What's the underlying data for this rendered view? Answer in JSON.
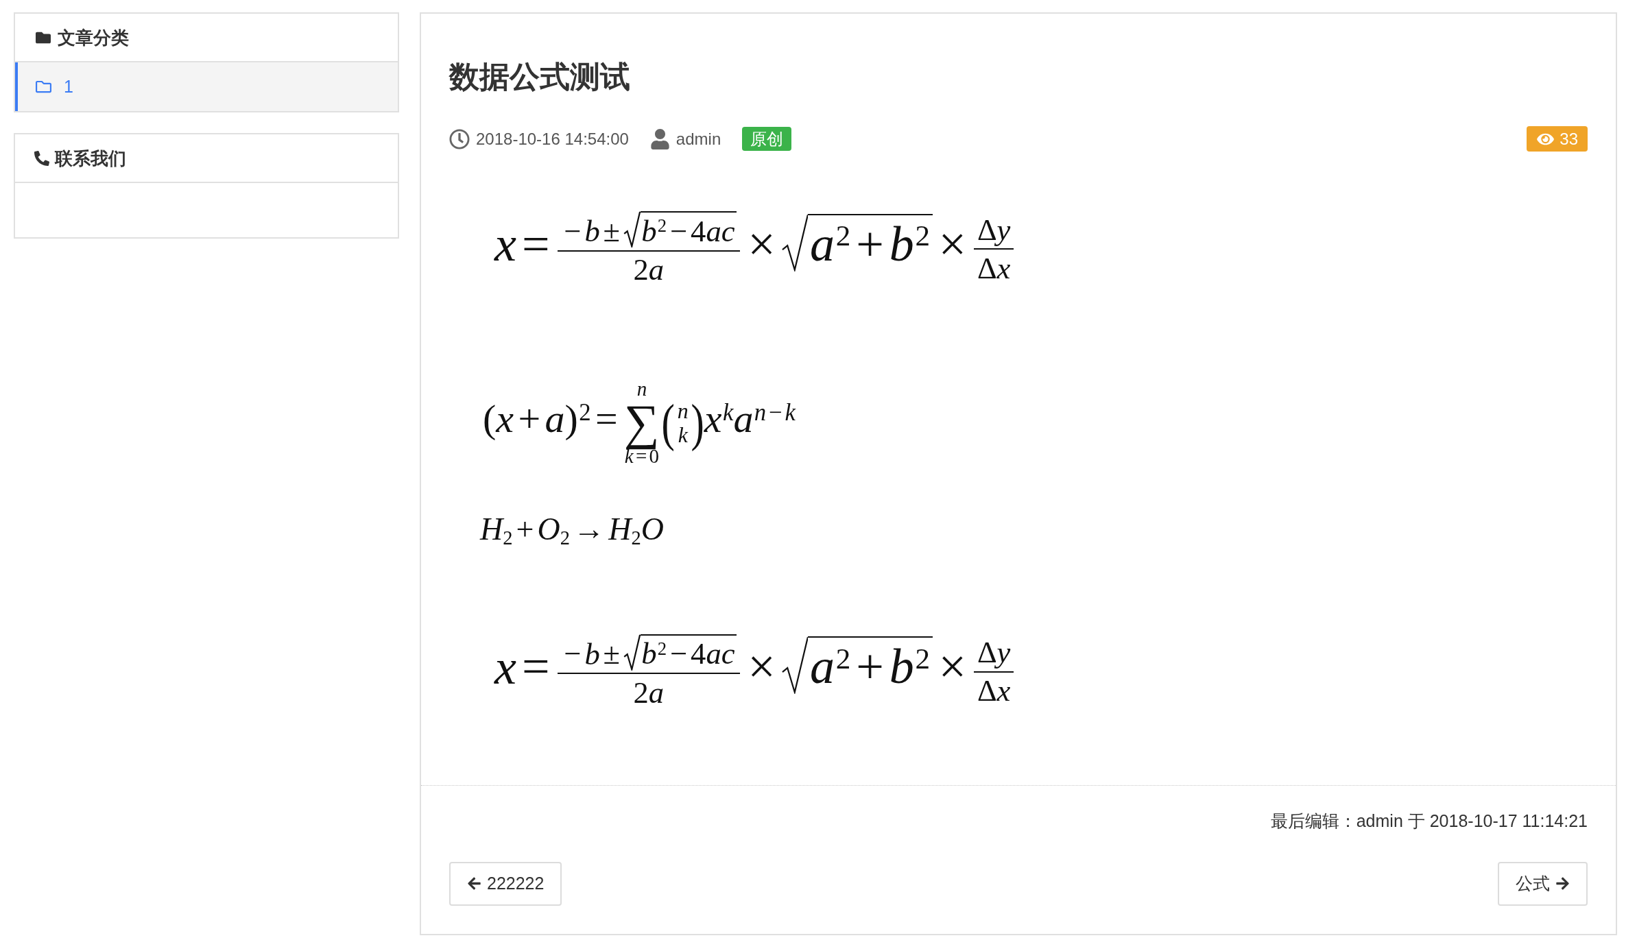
{
  "sidebar": {
    "panels": [
      {
        "kind": "categories",
        "title": "文章分类",
        "items": [
          {
            "label": "1",
            "selected": true
          }
        ]
      },
      {
        "kind": "contact",
        "title": "联系我们"
      }
    ]
  },
  "article": {
    "title": "数据公式测试",
    "meta": {
      "date": "2018-10-16 14:54:00",
      "author": "admin",
      "tag": "原创",
      "views": "33"
    },
    "formulas": [
      [
        {
          "kind": "var",
          "text": "x"
        },
        {
          "kind": "op",
          "text": "="
        },
        {
          "kind": "frac",
          "num": [
            {
              "kind": "op",
              "text": "−"
            },
            {
              "kind": "var",
              "text": "b"
            },
            {
              "kind": "op",
              "text": "±"
            },
            {
              "kind": "sqrt",
              "body": [
                {
                  "kind": "sup",
                  "base": [
                    {
                      "kind": "var",
                      "text": "b"
                    }
                  ],
                  "sup": [
                    {
                      "kind": "sym",
                      "text": "2"
                    }
                  ]
                },
                {
                  "kind": "op",
                  "text": "−"
                },
                {
                  "kind": "sym",
                  "text": "4"
                },
                {
                  "kind": "var",
                  "text": "ac"
                }
              ]
            }
          ],
          "den": [
            {
              "kind": "sym",
              "text": "2"
            },
            {
              "kind": "var",
              "text": "a"
            }
          ]
        },
        {
          "kind": "op",
          "text": "×"
        },
        {
          "kind": "sqrt",
          "body": [
            {
              "kind": "sup",
              "base": [
                {
                  "kind": "var",
                  "text": "a"
                }
              ],
              "sup": [
                {
                  "kind": "sym",
                  "text": "2"
                }
              ]
            },
            {
              "kind": "op",
              "text": "+"
            },
            {
              "kind": "sup",
              "base": [
                {
                  "kind": "var",
                  "text": "b"
                }
              ],
              "sup": [
                {
                  "kind": "sym",
                  "text": "2"
                }
              ]
            }
          ]
        },
        {
          "kind": "op",
          "text": "×"
        },
        {
          "kind": "frac",
          "num": [
            {
              "kind": "sym",
              "text": "Δ"
            },
            {
              "kind": "var",
              "text": "y"
            }
          ],
          "den": [
            {
              "kind": "sym",
              "text": "Δ"
            },
            {
              "kind": "var",
              "text": "x"
            }
          ]
        }
      ],
      [
        {
          "kind": "sym",
          "text": "("
        },
        {
          "kind": "var",
          "text": "x"
        },
        {
          "kind": "op",
          "text": "+"
        },
        {
          "kind": "var",
          "text": "a"
        },
        {
          "kind": "sup",
          "base": [
            {
              "kind": "sym",
              "text": ")"
            }
          ],
          "sup": [
            {
              "kind": "sym",
              "text": "2"
            }
          ]
        },
        {
          "kind": "op",
          "text": "="
        },
        {
          "kind": "sum",
          "symbol": "∑",
          "over": [
            {
              "kind": "var",
              "text": "n"
            }
          ],
          "under": [
            {
              "kind": "var",
              "text": "k"
            },
            {
              "kind": "op",
              "text": "="
            },
            {
              "kind": "sym",
              "text": "0"
            }
          ]
        },
        {
          "kind": "binom",
          "open": "(",
          "close": ")",
          "top": [
            {
              "kind": "var",
              "text": "n"
            }
          ],
          "bottom": [
            {
              "kind": "var",
              "text": "k"
            }
          ]
        },
        {
          "kind": "sup",
          "base": [
            {
              "kind": "var",
              "text": "x"
            }
          ],
          "sup": [
            {
              "kind": "var",
              "text": "k"
            }
          ]
        },
        {
          "kind": "sup",
          "base": [
            {
              "kind": "var",
              "text": "a"
            }
          ],
          "sup": [
            {
              "kind": "var",
              "text": "n"
            },
            {
              "kind": "op",
              "text": "−"
            },
            {
              "kind": "var",
              "text": "k"
            }
          ]
        }
      ],
      [
        {
          "kind": "sub",
          "base": [
            {
              "kind": "var",
              "text": "H"
            }
          ],
          "sub": [
            {
              "kind": "sym",
              "text": "2"
            }
          ]
        },
        {
          "kind": "op",
          "text": "+"
        },
        {
          "kind": "sub",
          "base": [
            {
              "kind": "var",
              "text": "O"
            }
          ],
          "sub": [
            {
              "kind": "sym",
              "text": "2"
            }
          ]
        },
        {
          "kind": "op",
          "text": "→"
        },
        {
          "kind": "sub",
          "base": [
            {
              "kind": "var",
              "text": "H"
            }
          ],
          "sub": [
            {
              "kind": "sym",
              "text": "2"
            }
          ]
        },
        {
          "kind": "var",
          "text": "O"
        }
      ],
      [
        {
          "kind": "var",
          "text": "x"
        },
        {
          "kind": "op",
          "text": "="
        },
        {
          "kind": "frac",
          "num": [
            {
              "kind": "op",
              "text": "−"
            },
            {
              "kind": "var",
              "text": "b"
            },
            {
              "kind": "op",
              "text": "±"
            },
            {
              "kind": "sqrt",
              "body": [
                {
                  "kind": "sup",
                  "base": [
                    {
                      "kind": "var",
                      "text": "b"
                    }
                  ],
                  "sup": [
                    {
                      "kind": "sym",
                      "text": "2"
                    }
                  ]
                },
                {
                  "kind": "op",
                  "text": "−"
                },
                {
                  "kind": "sym",
                  "text": "4"
                },
                {
                  "kind": "var",
                  "text": "ac"
                }
              ]
            }
          ],
          "den": [
            {
              "kind": "sym",
              "text": "2"
            },
            {
              "kind": "var",
              "text": "a"
            }
          ]
        },
        {
          "kind": "op",
          "text": "×"
        },
        {
          "kind": "sqrt",
          "body": [
            {
              "kind": "sup",
              "base": [
                {
                  "kind": "var",
                  "text": "a"
                }
              ],
              "sup": [
                {
                  "kind": "sym",
                  "text": "2"
                }
              ]
            },
            {
              "kind": "op",
              "text": "+"
            },
            {
              "kind": "sup",
              "base": [
                {
                  "kind": "var",
                  "text": "b"
                }
              ],
              "sup": [
                {
                  "kind": "sym",
                  "text": "2"
                }
              ]
            }
          ]
        },
        {
          "kind": "op",
          "text": "×"
        },
        {
          "kind": "frac",
          "num": [
            {
              "kind": "sym",
              "text": "Δ"
            },
            {
              "kind": "var",
              "text": "y"
            }
          ],
          "den": [
            {
              "kind": "sym",
              "text": "Δ"
            },
            {
              "kind": "var",
              "text": "x"
            }
          ]
        }
      ]
    ],
    "last_edited": "最后编辑：admin 于 2018-10-17 11:14:21",
    "pager": {
      "previous": "222222",
      "next": "公式"
    }
  }
}
